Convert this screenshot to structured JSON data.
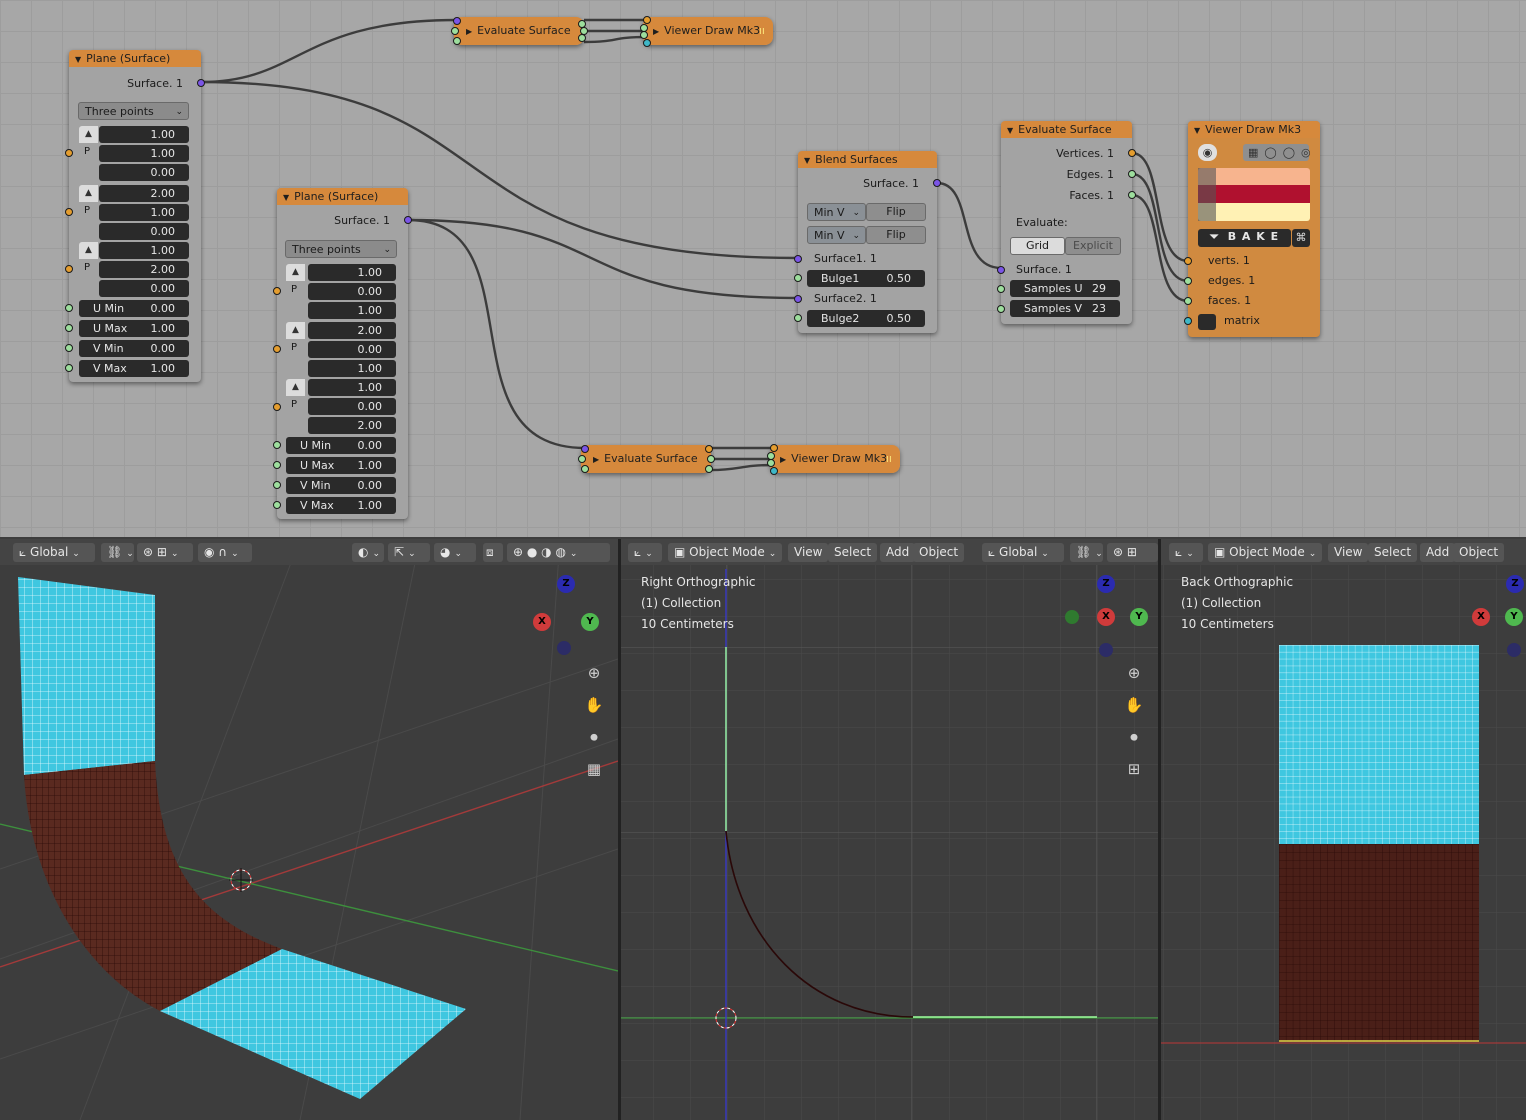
{
  "nodes": {
    "plane1": {
      "title": "Plane (Surface)",
      "output": "Surface. 1",
      "mode": "Three points",
      "p1": [
        "1.00",
        "1.00",
        "0.00"
      ],
      "p2": [
        "2.00",
        "1.00",
        "0.00"
      ],
      "p3": [
        "1.00",
        "2.00",
        "0.00"
      ],
      "p_label": "P",
      "umin": {
        "label": "U Min",
        "value": "0.00"
      },
      "umax": {
        "label": "U Max",
        "value": "1.00"
      },
      "vmin": {
        "label": "V Min",
        "value": "0.00"
      },
      "vmax": {
        "label": "V Max",
        "value": "1.00"
      }
    },
    "plane2": {
      "title": "Plane (Surface)",
      "output": "Surface. 1",
      "mode": "Three points",
      "p1": [
        "1.00",
        "0.00",
        "1.00"
      ],
      "p2": [
        "2.00",
        "0.00",
        "1.00"
      ],
      "p3": [
        "1.00",
        "0.00",
        "2.00"
      ],
      "p_label": "P",
      "umin": {
        "label": "U Min",
        "value": "0.00"
      },
      "umax": {
        "label": "U Max",
        "value": "1.00"
      },
      "vmin": {
        "label": "V Min",
        "value": "0.00"
      },
      "vmax": {
        "label": "V Max",
        "value": "1.00"
      }
    },
    "eval_top": {
      "title": "Evaluate Surface"
    },
    "viewer_top": {
      "title": "Viewer Draw Mk3"
    },
    "eval_bottom": {
      "title": "Evaluate Surface"
    },
    "viewer_bottom": {
      "title": "Viewer Draw Mk3"
    },
    "blend": {
      "title": "Blend Surfaces",
      "output": "Surface. 1",
      "min_v1": "Min V",
      "flip1": "Flip",
      "min_v2": "Min V",
      "flip2": "Flip",
      "in1": "Surface1. 1",
      "bulge1": {
        "label": "Bulge1",
        "value": "0.50"
      },
      "in2": "Surface2. 1",
      "bulge2": {
        "label": "Bulge2",
        "value": "0.50"
      }
    },
    "eval_main": {
      "title": "Evaluate Surface",
      "out_vertices": "Vertices. 1",
      "out_edges": "Edges. 1",
      "out_faces": "Faces. 1",
      "evaluate_label": "Evaluate:",
      "grid": "Grid",
      "explicit": "Explicit",
      "in_surface": "Surface. 1",
      "samples_u": {
        "label": "Samples U",
        "value": "29"
      },
      "samples_v": {
        "label": "Samples V",
        "value": "23"
      }
    },
    "viewer_main": {
      "title": "Viewer Draw Mk3",
      "bake": "B A K E",
      "in_verts": "verts. 1",
      "in_edges": "edges. 1",
      "in_faces": "faces. 1",
      "in_matrix": "matrix",
      "colors": {
        "verts": "#f7b48e",
        "edges": "#b0112f",
        "faces": "#fff1b4"
      }
    }
  },
  "viewport_left": {
    "orientation": "Global"
  },
  "viewport_mid": {
    "mode": "Object Mode",
    "menus": [
      "View",
      "Select",
      "Add",
      "Object"
    ],
    "orientation": "Global",
    "info": [
      "Right Orthographic",
      "(1) Collection",
      "10 Centimeters"
    ]
  },
  "viewport_right": {
    "mode": "Object Mode",
    "menus": [
      "View",
      "Select",
      "Add",
      "Object"
    ],
    "info": [
      "Back Orthographic",
      "(1) Collection",
      "10 Centimeters"
    ]
  },
  "gizmo": {
    "x": "X",
    "y": "Y",
    "z": "Z"
  },
  "colors": {
    "node_header": "#d6893c",
    "surface_cyan": "#3fc7e0",
    "surface_brown": "#5a2a20",
    "x_axis": "#d03b3b",
    "y_axis": "#4fb84f",
    "z_axis": "#3a3ad0"
  }
}
